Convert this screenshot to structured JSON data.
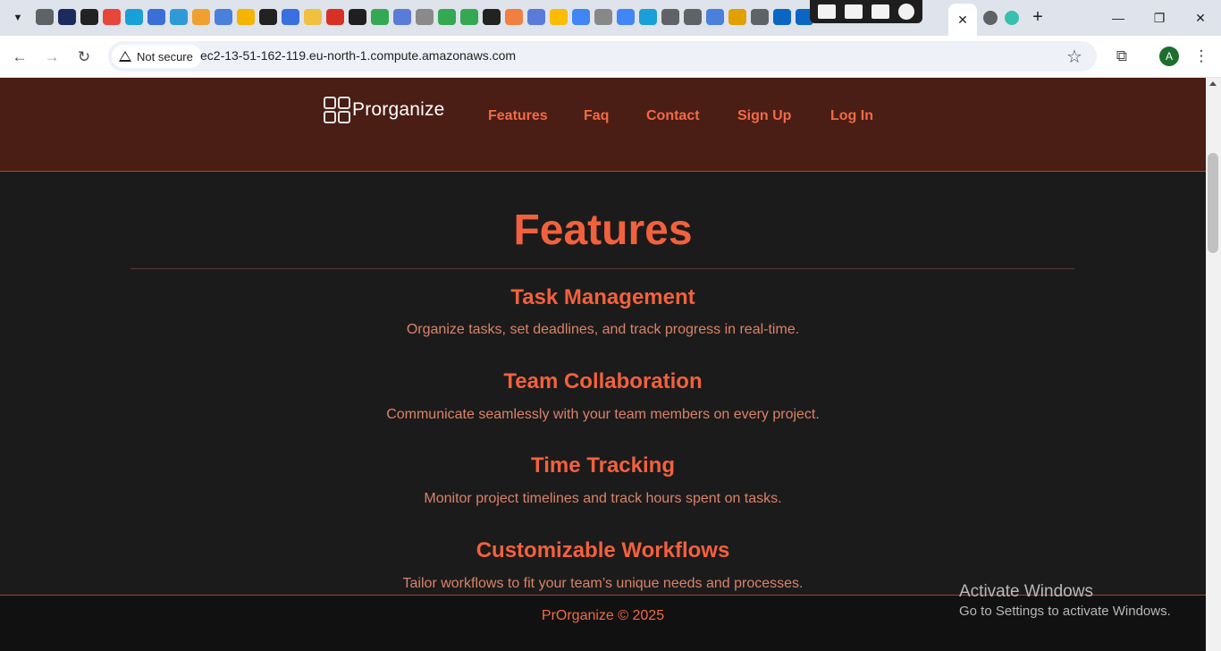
{
  "browser": {
    "favicon_colors": [
      "#5f6368",
      "#1a2b5c",
      "#222222",
      "#e8453c",
      "#1aa0d8",
      "#3b6fd8",
      "#2f9ad6",
      "#f0a030",
      "#4a7fdc",
      "#f4b400",
      "#222222",
      "#3a6fe0",
      "#f0c040",
      "#d93025",
      "#1f1f1f",
      "#34a853",
      "#5b7bd8",
      "#8a8a8a",
      "#34a853",
      "#34a853",
      "#222222",
      "#f08040",
      "#5b7bd8",
      "#fbbc04",
      "#4285f4",
      "#888888",
      "#4285f4",
      "#1aa0d8",
      "#5f6368",
      "#5f6368",
      "#4a7fdc",
      "#e0a000",
      "#5f6368",
      "#0a66c2",
      "#0a66c2"
    ],
    "extra_tab_colors": [
      "#5f6368",
      "#35c0b0"
    ],
    "active_tab_close": "✕",
    "new_tab_label": "+",
    "window": {
      "minimize": "—",
      "restore": "❐",
      "close": "✕"
    },
    "security_label": "Not secure",
    "url": "ec2-13-51-162-119.eu-north-1.compute.amazonaws.com",
    "avatar_letter": "A"
  },
  "site": {
    "brand": "Prorganize",
    "nav": [
      "Features",
      "Faq",
      "Contact",
      "Sign Up",
      "Log In"
    ],
    "heading": "Features",
    "features": [
      {
        "title": "Task Management",
        "description": "Organize tasks, set deadlines, and track progress in real-time."
      },
      {
        "title": "Team Collaboration",
        "description": "Communicate seamlessly with your team members on every project."
      },
      {
        "title": "Time Tracking",
        "description": "Monitor project timelines and track hours spent on tasks."
      },
      {
        "title": "Customizable Workflows",
        "description": "Tailor workflows to fit your team’s unique needs and processes."
      }
    ],
    "footer": "PrOrganize © 2025"
  },
  "os": {
    "watermark_title": "Activate Windows",
    "watermark_sub": "Go to Settings to activate Windows."
  },
  "colors": {
    "header_bg": "#4a1d15",
    "accent": "#f2613d",
    "page_bg": "#1c1b1b",
    "footer_bg": "#121111"
  }
}
